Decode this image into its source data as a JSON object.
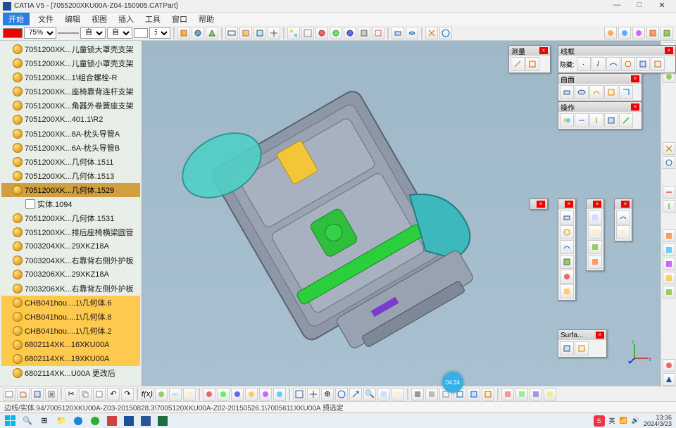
{
  "title": "CATIA V5 - [7055200XKU00A-Z04-150905.CATPart]",
  "menu": {
    "start": "开始",
    "items": [
      "文件",
      "编辑",
      "视图",
      "插入",
      "工具",
      "窗口",
      "帮助"
    ]
  },
  "toolbar1": {
    "zoom": "75%",
    "auto1": "自动",
    "auto2": "自动",
    "none": "无"
  },
  "tree": {
    "items": [
      {
        "label": "7051200XK...儿童锁大罩壳支架"
      },
      {
        "label": "7051200XK...儿童锁小罩壳支架"
      },
      {
        "label": "7051200XK...1\\组合螺栓-R"
      },
      {
        "label": "7051200XK...座椅靠背连杆支架"
      },
      {
        "label": "7051200XK...角器外卷簧座支架"
      },
      {
        "label": "7051200XK...401.1\\R2"
      },
      {
        "label": "7051200XK...8A-枕头导管A"
      },
      {
        "label": "7051200XK...6A-枕头导管B"
      },
      {
        "label": "7051200XK...几何体.1511"
      },
      {
        "label": "7051200XK...几何体.1513"
      },
      {
        "label": "7051200XK...几何体.1529",
        "sel": true
      },
      {
        "label": "实体.1094",
        "body": true,
        "indent": true
      },
      {
        "label": "7051200XK...几何体.1531"
      },
      {
        "label": "7051200XK...排后座椅横梁圆管"
      },
      {
        "label": "7003204XK...29XKZ18A"
      },
      {
        "label": "7003204XK...右靠背右侧外护板"
      },
      {
        "label": "7003206XK...29XKZ18A"
      },
      {
        "label": "7003206XK...右靠背左侧外护板"
      },
      {
        "label": "CHB041hou....1\\几何体.6",
        "hl": true
      },
      {
        "label": "CHB041hou....1\\几何体.8",
        "hl": true
      },
      {
        "label": "CHB041hou....1\\几何体.2",
        "hl": true
      },
      {
        "label": "6802114XK...16XKU00A",
        "hl": true
      },
      {
        "label": "6802114XK...19XKU00A",
        "hl": true
      },
      {
        "label": "6802114XK...U00A 更改后"
      }
    ]
  },
  "floats": {
    "measure": {
      "title": "测量"
    },
    "wire": {
      "title": "线框",
      "hide": "隐藏:"
    },
    "surf": {
      "title": "曲面"
    },
    "op": {
      "title": "操作"
    },
    "surfa": {
      "title": "Surfa..."
    }
  },
  "status": "边线/实体.94/7005120XKU00A-Z03-20150828.3\\7005120XKU00A-Z02-20150526.1\\7005611XKU00A 预选定",
  "clock": "04:24",
  "compass": {
    "x": "x",
    "y": "y",
    "z": "z"
  },
  "taskbar": {
    "ime": "英",
    "sogou": "S",
    "time": "13:36",
    "date": "2024/3/23"
  }
}
